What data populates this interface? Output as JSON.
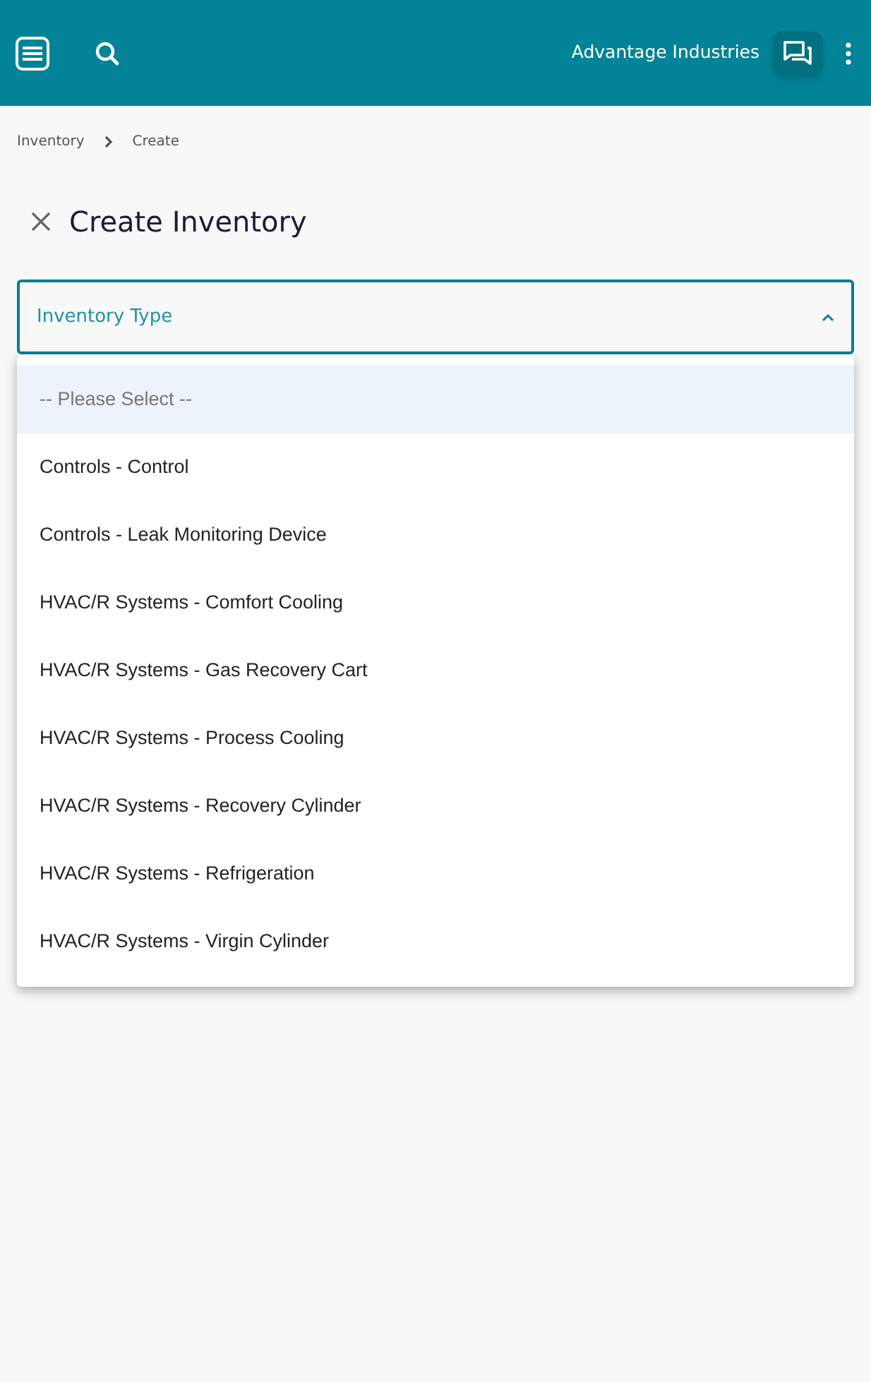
{
  "header": {
    "company": "Advantage Industries"
  },
  "breadcrumb": [
    {
      "label": "Inventory"
    },
    {
      "label": "Create"
    }
  ],
  "page": {
    "title": "Create Inventory"
  },
  "field": {
    "label": "Inventory Type",
    "expanded": true
  },
  "options": [
    {
      "label": "-- Please Select --",
      "kind": "placeholder",
      "selected": true
    },
    {
      "label": "Controls - Control",
      "kind": "option",
      "selected": false
    },
    {
      "label": "Controls - Leak Monitoring Device",
      "kind": "option",
      "selected": false
    },
    {
      "label": "HVAC/R Systems - Comfort Cooling",
      "kind": "option",
      "selected": false
    },
    {
      "label": "HVAC/R Systems - Gas Recovery Cart",
      "kind": "option",
      "selected": false
    },
    {
      "label": "HVAC/R Systems - Process Cooling",
      "kind": "option",
      "selected": false
    },
    {
      "label": "HVAC/R Systems - Recovery Cylinder",
      "kind": "option",
      "selected": false
    },
    {
      "label": "HVAC/R Systems - Refrigeration",
      "kind": "option",
      "selected": false
    },
    {
      "label": "HVAC/R Systems - Virgin Cylinder",
      "kind": "option",
      "selected": false
    }
  ]
}
